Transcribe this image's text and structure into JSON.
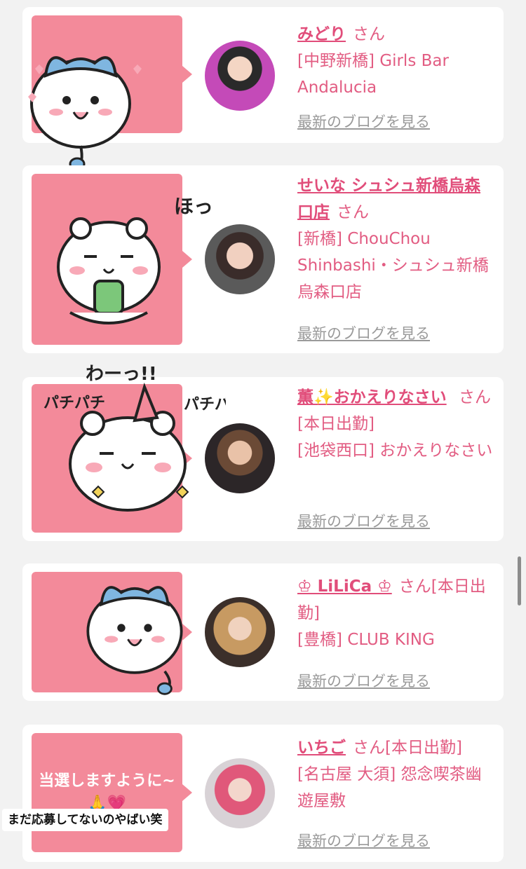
{
  "cards": [
    {
      "name": "みどり",
      "honorific": "さん",
      "status": "",
      "shop": "[中野新橋] Girls Bar Andalucia",
      "blog_link": "最新のブログを見る",
      "bubble_text": ""
    },
    {
      "name": "せいな シュシュ新橋烏森口店",
      "honorific": "さん",
      "status": "",
      "shop": "[新橋] ChouChou Shinbashi・シュシュ新橋烏森口店",
      "blog_link": "最新のブログを見る",
      "bubble_text": ""
    },
    {
      "name": "薫✨おかえりなさい",
      "honorific": "さん",
      "status": "[本日出勤]",
      "shop": "[池袋西口] おかえりなさい",
      "blog_link": "最新のブログを見る",
      "bubble_text": ""
    },
    {
      "name": "♔ LiLiCa ♔",
      "honorific": "さん",
      "status": "[本日出勤]",
      "shop": "[豊橋] CLUB KING",
      "blog_link": "最新のブログを見る",
      "bubble_text": ""
    },
    {
      "name": "いちご",
      "honorific": "さん",
      "status": "[本日出勤]",
      "shop": "[名古屋 大須] 怨念喫茶幽遊屋敷",
      "blog_link": "最新のブログを見る",
      "bubble_text": "当選しますように~🙏💗"
    }
  ],
  "sticker_texts": {
    "hoh": "ほっ……",
    "wah": "わーっ!!",
    "pachi_left": "パチパチ",
    "pachi_right": "パチパチ"
  },
  "overlay_caption": "まだ応募してないのやばい笑",
  "colors": {
    "background": "#f2f2f2",
    "card": "#ffffff",
    "bubble": "#f38a9a",
    "accent": "#e14d7a",
    "link_gray": "#9a9a9a"
  }
}
